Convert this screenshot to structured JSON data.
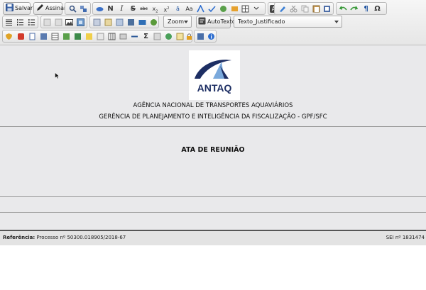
{
  "toolbar": {
    "save_label": "Salvar",
    "sign_label": "Assinar",
    "bold_label": "N",
    "italic_label": "I",
    "strike_label": "S",
    "omega_label": "Ω",
    "zoom_label": "Zoom",
    "autotext_label": "AutoTexto",
    "style_value": "Texto_Justificado",
    "sigma_label": "Σ"
  },
  "document": {
    "logo_text": "ANTAQ",
    "agency": "AGÊNCIA NACIONAL DE TRANSPORTES AQUAVIÁRIOS",
    "department": "GERÊNCIA DE PLANEJAMENTO E INTELIGÊNCIA DA FISCALIZAÇÃO - GPF/SFC",
    "title": "ATA DE REUNIÃO"
  },
  "footer": {
    "ref_label": "Referência:",
    "ref_value": "Processo nº 50300.018905/2018-67",
    "sei": "SEI nº 1831474"
  },
  "colors": {
    "toolbar_bg": "#ececec",
    "editor_bg": "#e9e9eb",
    "logo_navy": "#1d2e63",
    "logo_sky": "#7aa9dc"
  }
}
